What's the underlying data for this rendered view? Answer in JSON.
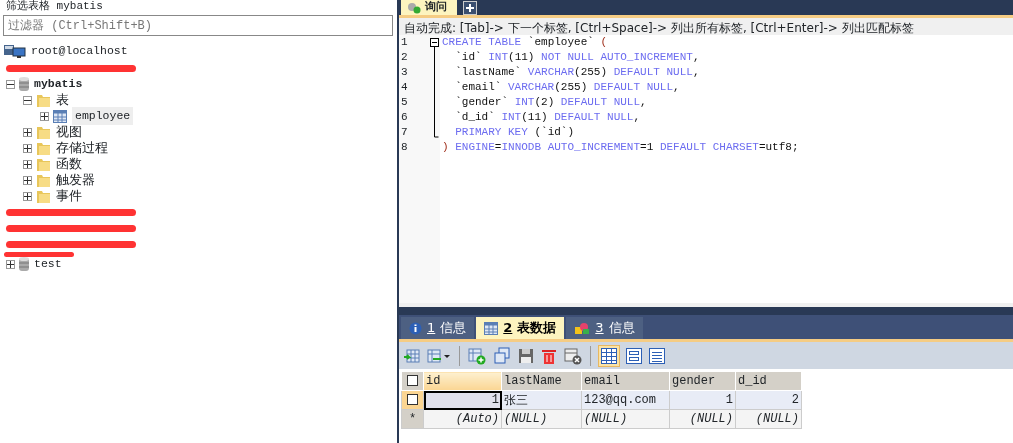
{
  "left_panel": {
    "title": "筛选表格 mybatis",
    "filter": {
      "placeholder": "过滤器 (Ctrl+Shift+B)"
    },
    "tree": [
      {
        "label": "root@localhost",
        "kind": "server",
        "children": [
          {
            "kind": "redacted"
          },
          {
            "label": "mybatis",
            "kind": "database",
            "expanded": true,
            "children": [
              {
                "label": "表",
                "kind": "folder",
                "expanded": true,
                "children": [
                  {
                    "label": "employee",
                    "kind": "table",
                    "expanded": false,
                    "selected": true
                  }
                ]
              },
              {
                "label": "视图",
                "kind": "folder",
                "expanded": false
              },
              {
                "label": "存储过程",
                "kind": "folder",
                "expanded": false
              },
              {
                "label": "函数",
                "kind": "folder",
                "expanded": false
              },
              {
                "label": "触发器",
                "kind": "folder",
                "expanded": false
              },
              {
                "label": "事件",
                "kind": "folder",
                "expanded": false
              }
            ]
          },
          {
            "kind": "redacted"
          },
          {
            "kind": "redacted"
          },
          {
            "kind": "redacted"
          },
          {
            "label": "test",
            "kind": "redacted_partial",
            "expanded": false
          }
        ]
      }
    ]
  },
  "editor": {
    "tab": {
      "label": "询问",
      "selected": true
    },
    "hint": "自动完成: [Tab]-> 下一个标签, [Ctrl+Space]-> 列出所有标签, [Ctrl+Enter]-> 列出匹配标签",
    "lines": [
      {
        "num": "1",
        "tokens": [
          {
            "text": "CREATE TABLE ",
            "kind": "keyword"
          },
          {
            "text": "`employee`",
            "kind": "identifier"
          },
          {
            "text": " (",
            "kind": "paren"
          }
        ]
      },
      {
        "num": "2",
        "tokens": [
          {
            "text": "  `id` ",
            "kind": "identifier"
          },
          {
            "text": "INT",
            "kind": "keyword"
          },
          {
            "text": "(11) ",
            "kind": "identifier"
          },
          {
            "text": "NOT NULL AUTO_INCREMENT",
            "kind": "keyword"
          },
          {
            "text": ",",
            "kind": "identifier"
          }
        ]
      },
      {
        "num": "3",
        "tokens": [
          {
            "text": "  `lastName` ",
            "kind": "identifier"
          },
          {
            "text": "VARCHAR",
            "kind": "keyword"
          },
          {
            "text": "(255) ",
            "kind": "identifier"
          },
          {
            "text": "DEFAULT NULL",
            "kind": "keyword"
          },
          {
            "text": ",",
            "kind": "identifier"
          }
        ]
      },
      {
        "num": "4",
        "tokens": [
          {
            "text": "  `email` ",
            "kind": "identifier"
          },
          {
            "text": "VARCHAR",
            "kind": "keyword"
          },
          {
            "text": "(255) ",
            "kind": "identifier"
          },
          {
            "text": "DEFAULT NULL",
            "kind": "keyword"
          },
          {
            "text": ",",
            "kind": "identifier"
          }
        ]
      },
      {
        "num": "5",
        "tokens": [
          {
            "text": "  `gender` ",
            "kind": "identifier"
          },
          {
            "text": "INT",
            "kind": "keyword"
          },
          {
            "text": "(2) ",
            "kind": "identifier"
          },
          {
            "text": "DEFAULT NULL",
            "kind": "keyword"
          },
          {
            "text": ",",
            "kind": "identifier"
          }
        ]
      },
      {
        "num": "6",
        "tokens": [
          {
            "text": "  `d_id` ",
            "kind": "identifier"
          },
          {
            "text": "INT",
            "kind": "keyword"
          },
          {
            "text": "(11) ",
            "kind": "identifier"
          },
          {
            "text": "DEFAULT NULL",
            "kind": "keyword"
          },
          {
            "text": ",",
            "kind": "identifier"
          }
        ]
      },
      {
        "num": "7",
        "tokens": [
          {
            "text": "  PRIMARY KEY",
            "kind": "keyword"
          },
          {
            "text": " (`id`)",
            "kind": "identifier"
          }
        ]
      },
      {
        "num": "8",
        "tokens": [
          {
            "text": ")",
            "kind": "paren"
          },
          {
            "text": " ENGINE",
            "kind": "keyword"
          },
          {
            "text": "=",
            "kind": "identifier"
          },
          {
            "text": "INNODB AUTO_INCREMENT",
            "kind": "keyword"
          },
          {
            "text": "=1 ",
            "kind": "identifier"
          },
          {
            "text": "DEFAULT CHARSET",
            "kind": "keyword"
          },
          {
            "text": "=utf8;",
            "kind": "identifier"
          }
        ]
      }
    ]
  },
  "result": {
    "tabs": [
      {
        "num": "1",
        "label": "信息",
        "kind": "info",
        "selected": false
      },
      {
        "num": "2",
        "label": "表数据",
        "kind": "table",
        "selected": true
      },
      {
        "num": "3",
        "label": "信息",
        "kind": "profile",
        "selected": false
      }
    ],
    "view_modes": [
      {
        "kind": "grid",
        "selected": true
      },
      {
        "kind": "form",
        "selected": false
      },
      {
        "kind": "text",
        "selected": false
      }
    ],
    "table": {
      "select_all": {
        "checked": false
      },
      "columns": [
        {
          "label": "id",
          "selected": true
        },
        {
          "label": "lastName",
          "selected": false
        },
        {
          "label": "email",
          "selected": false
        },
        {
          "label": "gender",
          "selected": false
        },
        {
          "label": "d_id",
          "selected": false
        }
      ],
      "rows": [
        {
          "marker": "",
          "checked": false,
          "selected": true,
          "cells": [
            "1",
            "张三",
            "123@qq.com",
            "1",
            "2"
          ]
        },
        {
          "marker": "*",
          "selected": false,
          "cells": [
            "(Auto)",
            "(NULL)",
            "(NULL)",
            "(NULL)",
            "(NULL)"
          ]
        }
      ]
    }
  }
}
